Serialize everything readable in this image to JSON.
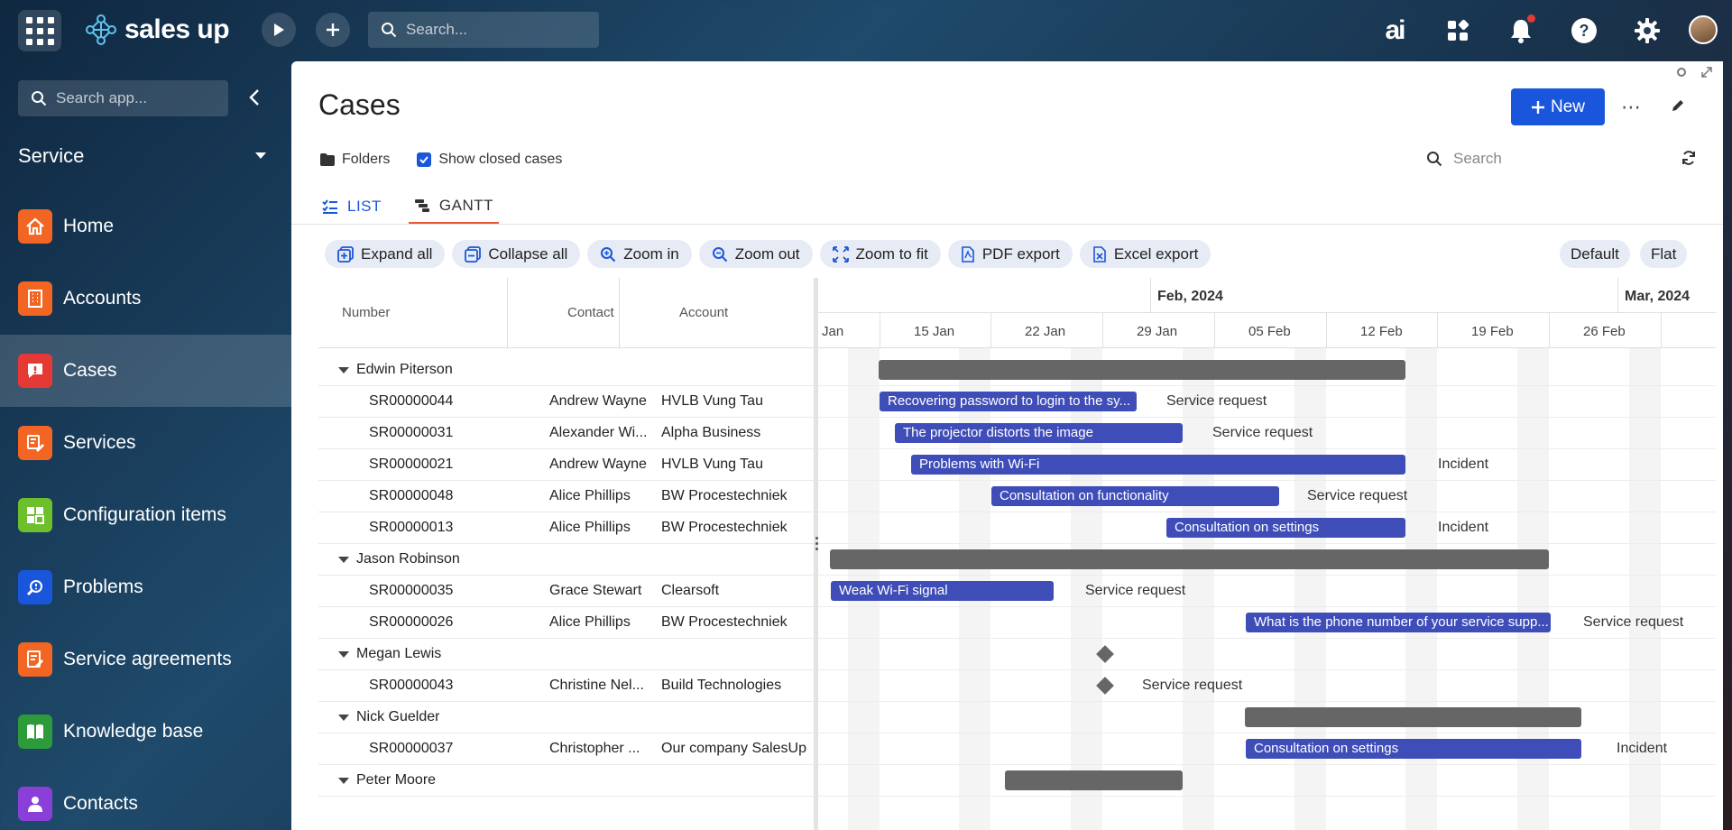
{
  "topbar": {
    "brand": "sales up",
    "search_placeholder": "Search...",
    "ai_label": "ai"
  },
  "sidebar": {
    "search_placeholder": "Search app...",
    "workspace": "Service",
    "items": [
      {
        "label": "Home",
        "icon": "home-icon",
        "color": "#f26522"
      },
      {
        "label": "Accounts",
        "icon": "building-icon",
        "color": "#f26522"
      },
      {
        "label": "Cases",
        "icon": "alert-icon",
        "color": "#e53935"
      },
      {
        "label": "Services",
        "icon": "services-icon",
        "color": "#f26522"
      },
      {
        "label": "Configuration items",
        "icon": "config-icon",
        "color": "#6dbf2b"
      },
      {
        "label": "Problems",
        "icon": "problem-icon",
        "color": "#1a56db"
      },
      {
        "label": "Service agreements",
        "icon": "agreement-icon",
        "color": "#f26522"
      },
      {
        "label": "Knowledge base",
        "icon": "book-icon",
        "color": "#2e9b3a"
      },
      {
        "label": "Contacts",
        "icon": "contact-icon",
        "color": "#8b3fd9"
      }
    ]
  },
  "page": {
    "title": "Cases",
    "new_label": "New",
    "folders_label": "Folders",
    "show_closed_label": "Show closed cases",
    "search_placeholder": "Search",
    "tabs": [
      {
        "label": "LIST"
      },
      {
        "label": "GANTT"
      }
    ]
  },
  "gantt_toolbar": {
    "expand_all": "Expand all",
    "collapse_all": "Collapse all",
    "zoom_in": "Zoom in",
    "zoom_out": "Zoom out",
    "zoom_to_fit": "Zoom to fit",
    "pdf_export": "PDF export",
    "excel_export": "Excel export",
    "view_default": "Default",
    "view_flat": "Flat"
  },
  "grid": {
    "columns": [
      "Number",
      "Contact",
      "Account"
    ],
    "rows": [
      {
        "group": "Edwin Piterson"
      },
      {
        "number": "SR00000044",
        "contact": "Andrew Wayne",
        "account": "HVLB Vung Tau",
        "task": "Recovering password to login to the sy...",
        "type": "Service request"
      },
      {
        "number": "SR00000031",
        "contact": "Alexander Wi...",
        "account": "Alpha Business",
        "task": "The projector distorts the image",
        "type": "Service request"
      },
      {
        "number": "SR00000021",
        "contact": "Andrew Wayne",
        "account": "HVLB Vung Tau",
        "task": "Problems with Wi-Fi",
        "type": "Incident"
      },
      {
        "number": "SR00000048",
        "contact": "Alice Phillips",
        "account": "BW Procestechniek",
        "task": "Consultation on functionality",
        "type": "Service request"
      },
      {
        "number": "SR00000013",
        "contact": "Alice Phillips",
        "account": "BW Procestechniek",
        "task": "Consultation on settings",
        "type": "Incident"
      },
      {
        "group": "Jason Robinson"
      },
      {
        "number": "SR00000035",
        "contact": "Grace Stewart",
        "account": "Clearsoft",
        "task": "Weak Wi-Fi signal",
        "type": "Service request"
      },
      {
        "number": "SR00000026",
        "contact": "Alice Phillips",
        "account": "BW Procestechniek",
        "task": "What is the phone number of your service supp...",
        "type": "Service request"
      },
      {
        "group": "Megan Lewis"
      },
      {
        "number": "SR00000043",
        "contact": "Christine Nel...",
        "account": "Build Technologies",
        "task": "",
        "type": "Service request"
      },
      {
        "group": "Nick Guelder"
      },
      {
        "number": "SR00000037",
        "contact": "Christopher ...",
        "account": "Our company SalesUp",
        "task": "Consultation on settings",
        "type": "Incident"
      },
      {
        "group": "Peter Moore"
      }
    ]
  },
  "timeline": {
    "months": [
      "Feb, 2024",
      "Mar, 2024"
    ],
    "weeks": [
      "Jan",
      "15 Jan",
      "22 Jan",
      "29 Jan",
      "05 Feb",
      "12 Feb",
      "19 Feb",
      "26 Feb"
    ]
  },
  "colors": {
    "accent": "#1a56db",
    "task_bar": "#3f4db8",
    "summary_bar": "#666666",
    "tab_underline": "#e8563a"
  }
}
